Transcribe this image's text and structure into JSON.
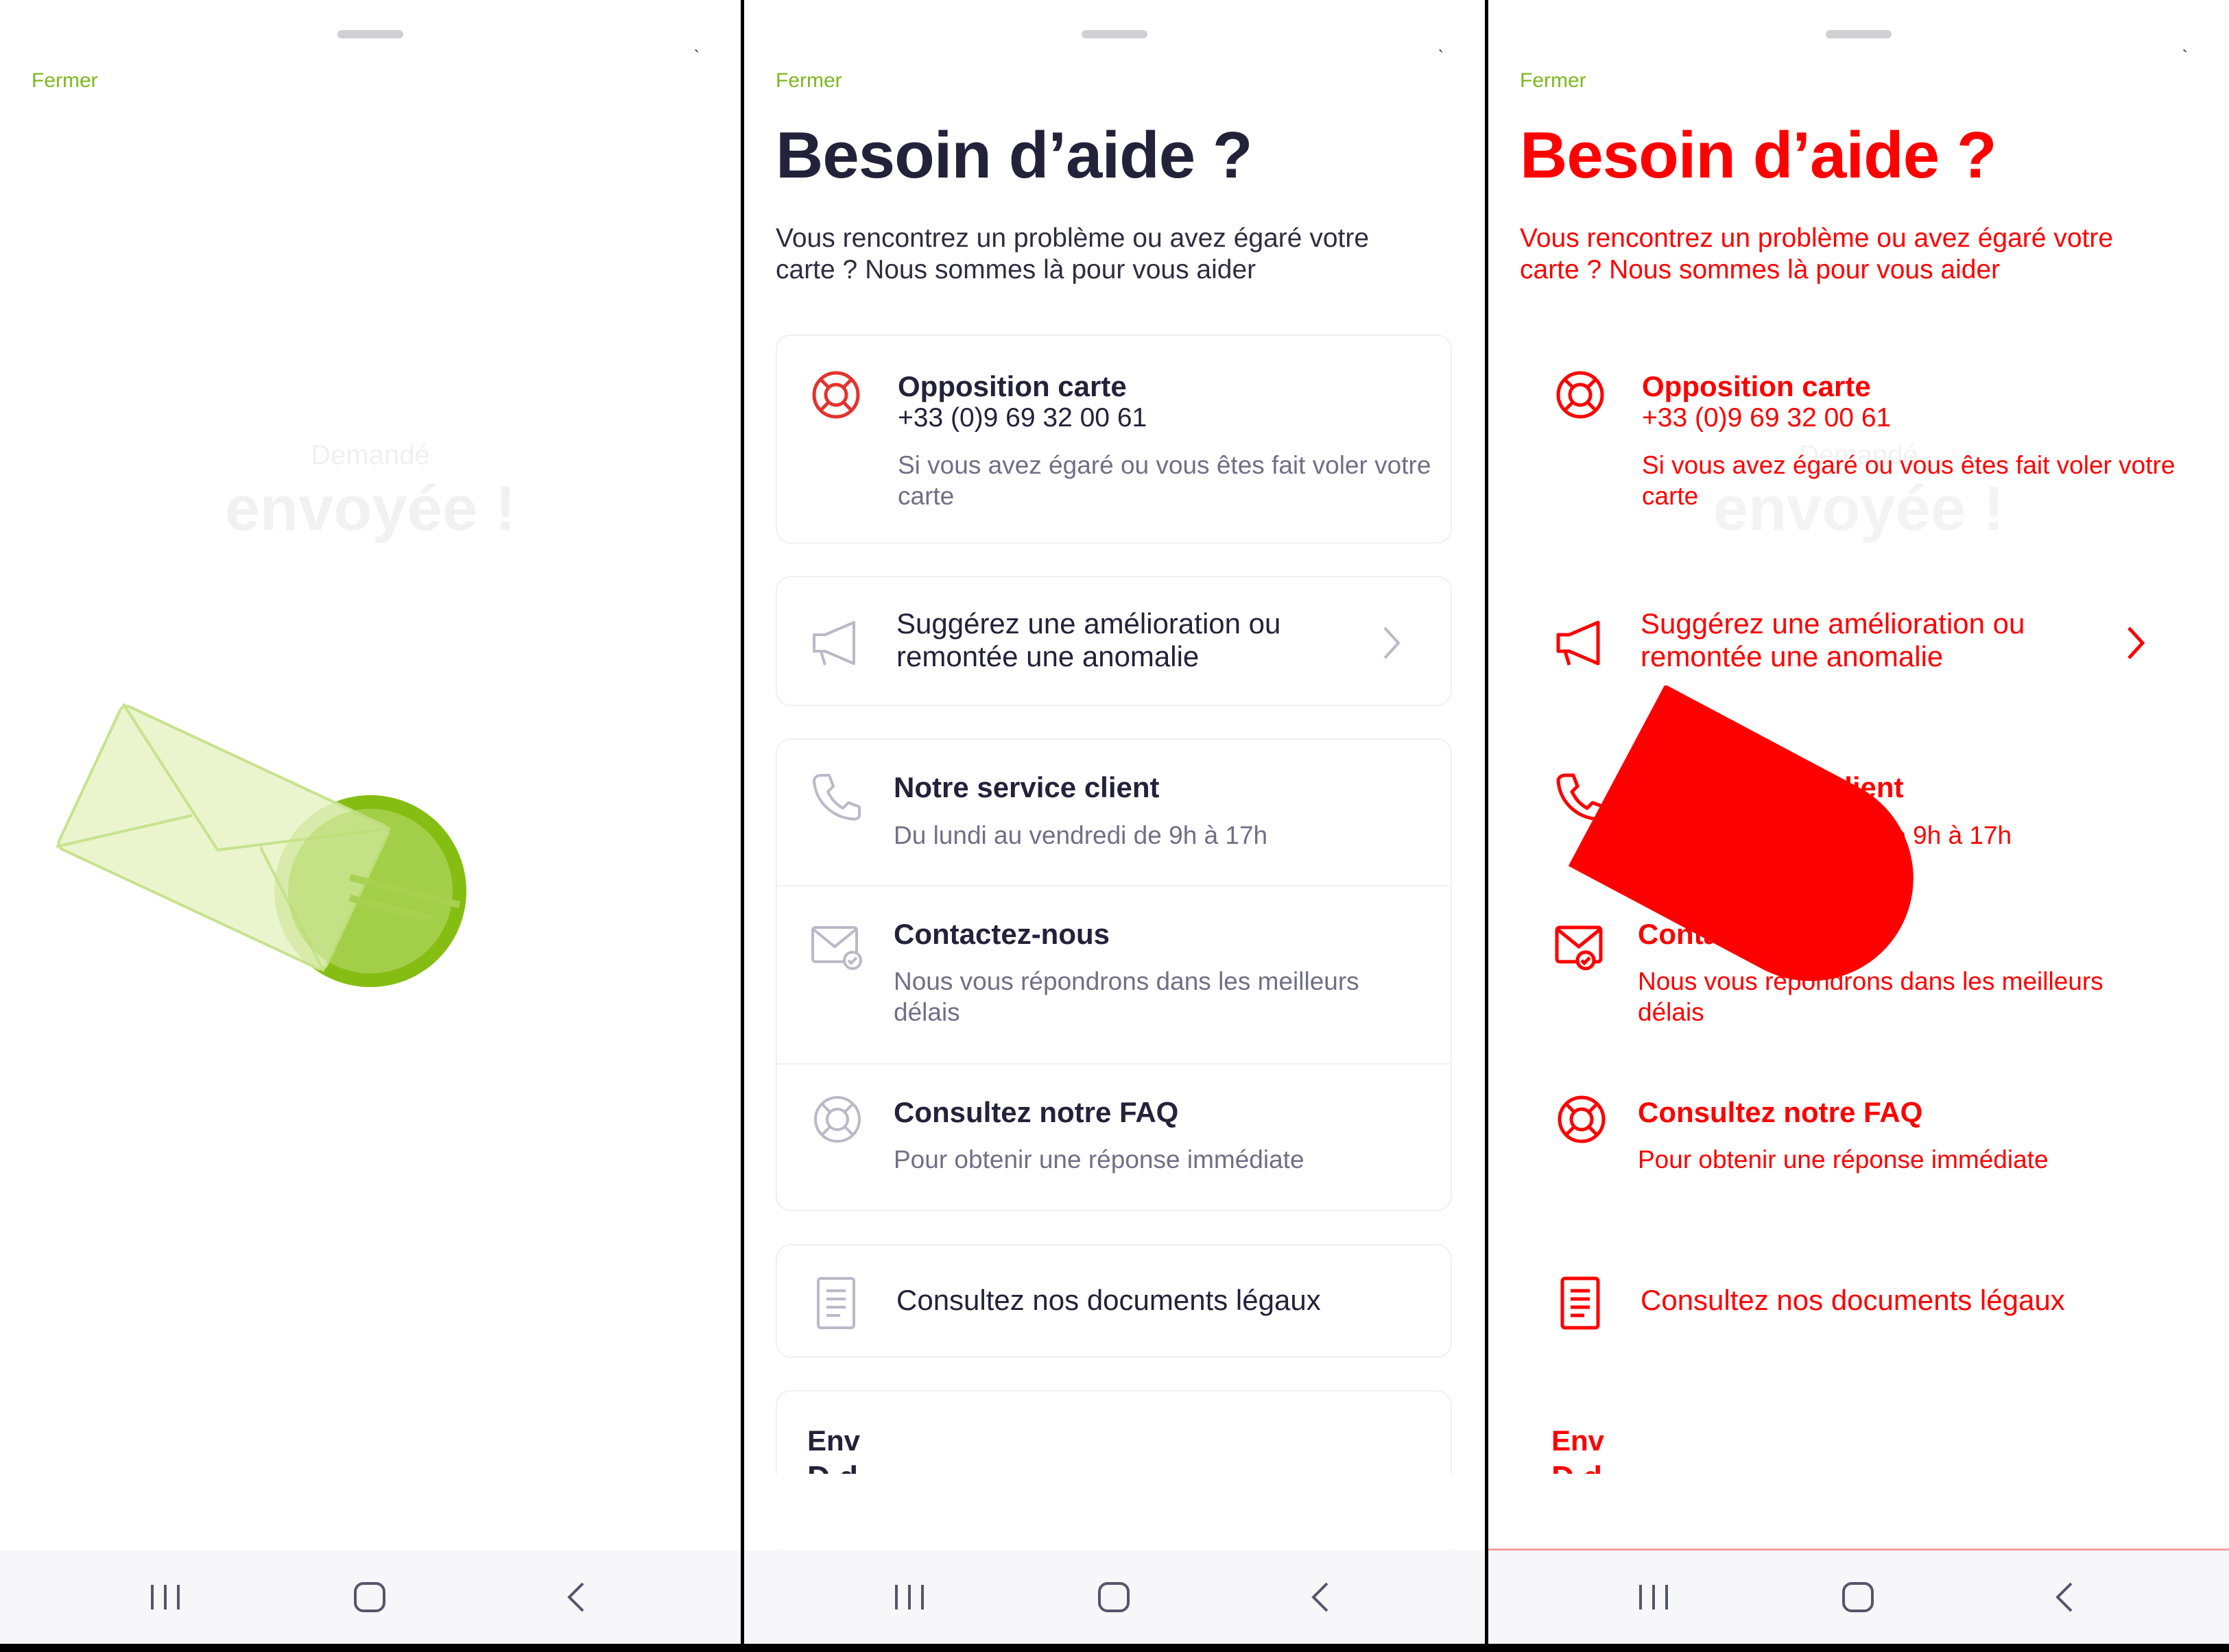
{
  "close_label": "Fermer",
  "status_tick": "ˏ",
  "sent": {
    "small": "Demandé",
    "big": "envoyée !"
  },
  "help": {
    "title": "Besoin d’aide ?",
    "subtitle": "Vous rencontrez un problème ou avez égaré votre carte ? Nous sommes là pour vous aider",
    "opposition": {
      "title": "Opposition carte",
      "phone": "+33 (0)9 69 32 00 61",
      "desc": "Si vous avez égaré ou vous êtes fait voler votre carte",
      "icon": "lifebuoy-icon"
    },
    "suggest": {
      "label": "Suggérez une amélioration ou remontée une anomalie",
      "icon": "megaphone-icon"
    },
    "service": {
      "title": "Notre service client",
      "desc": "Du lundi au vendredi de 9h à 17h",
      "icon": "phone-icon"
    },
    "contact": {
      "title": "Contactez-nous",
      "desc": "Nous vous répondrons dans les meilleurs délais",
      "icon": "mail-check-icon"
    },
    "faq": {
      "title": "Consultez notre FAQ",
      "desc": "Pour obtenir une réponse immédiate",
      "icon": "lifebuoy-icon"
    },
    "legal": {
      "label": "Consultez nos documents légaux",
      "icon": "document-icon"
    },
    "partial": {
      "line1": "Env",
      "line2": "D       d"
    }
  },
  "colors": {
    "accent_green": "#7cb81e",
    "title_dark": "#22223a",
    "muted": "#6f6f86",
    "overlay_red": "#fd0000"
  },
  "nav": {
    "recent": "recent-apps-icon",
    "home": "home-icon",
    "back": "back-icon"
  }
}
